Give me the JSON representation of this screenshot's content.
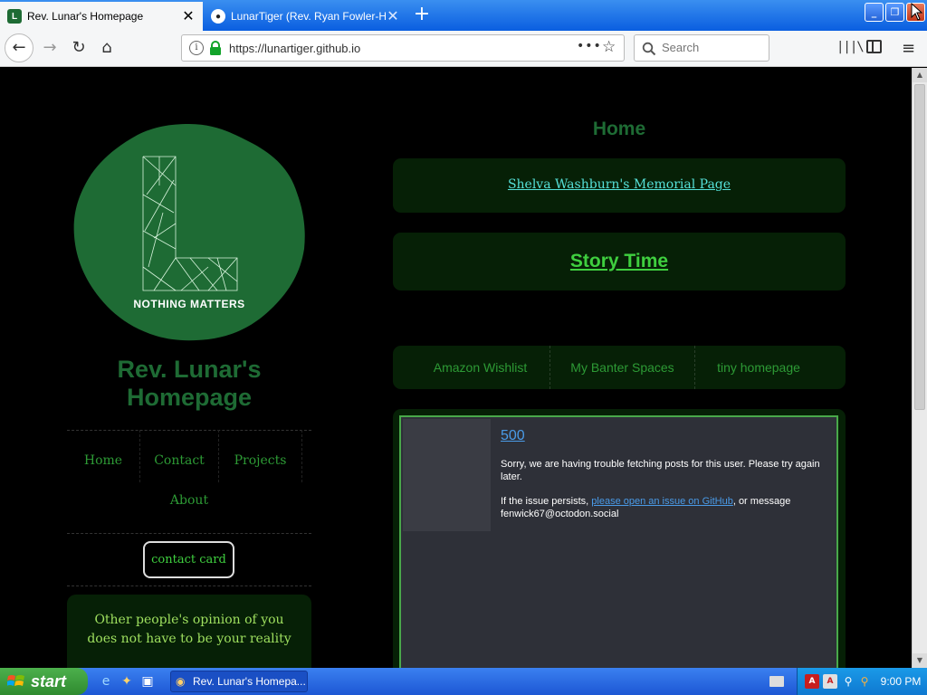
{
  "browser": {
    "tabs": [
      {
        "label": "Rev. Lunar's Homepage",
        "favicon": "L",
        "close": "✕"
      },
      {
        "label": "LunarTiger (Rev. Ryan Fowler-Hu",
        "favicon": "●",
        "close": "✕"
      }
    ],
    "new_tab": "+",
    "window_controls": {
      "minimize": "_",
      "maximize": "❐",
      "close": "✕"
    },
    "nav": {
      "back": "←",
      "forward": "→",
      "reload": "↻",
      "home": "⌂"
    },
    "url": "https://lunartiger.github.io",
    "page_actions": "•••",
    "bookmark_star": "☆",
    "search_placeholder": "Search",
    "library": "|||\\",
    "menu": "≡"
  },
  "sidebar": {
    "logo_text": "NOTHING MATTERS",
    "title": "Rev. Lunar's Homepage",
    "nav": {
      "home": "Home",
      "contact": "Contact",
      "projects": "Projects",
      "about": "About"
    },
    "contact_card": "contact card",
    "quote": "Other people's opinion of you does not have to be your reality"
  },
  "main": {
    "heading": "Home",
    "memorial_link": "Shelva Washburn's Memorial Page",
    "story_link": "Story Time",
    "ext_links": {
      "amazon": "Amazon Wishlist",
      "banter": "My Banter Spaces",
      "tiny": "tiny homepage"
    },
    "feed": {
      "error_code": "500",
      "message_1": "Sorry, we are having trouble fetching posts for this user. Please try again later.",
      "message_2_prefix": "If the issue persists, ",
      "github_link": "please open an issue on GitHub",
      "message_2_suffix": ", or message fenwick67@octodon.social"
    }
  },
  "scrollbar": {
    "up": "▲",
    "down": "▼"
  },
  "taskbar": {
    "start": "start",
    "task_button": "Rev. Lunar's Homepa...",
    "quick_launch": {
      "ie": "e",
      "player": "✦",
      "desktop": "▣"
    },
    "tray": {
      "pdf": "A",
      "pdf2": "A",
      "network": "⚲",
      "search": "⚲"
    },
    "clock": "9:00 PM"
  },
  "colors": {
    "brand_green": "#1e6b34",
    "link_green": "#2d9a35",
    "panel_bg": "#062006",
    "accent_cyan": "#55e0d8",
    "xp_blue": "#1d57d4"
  }
}
